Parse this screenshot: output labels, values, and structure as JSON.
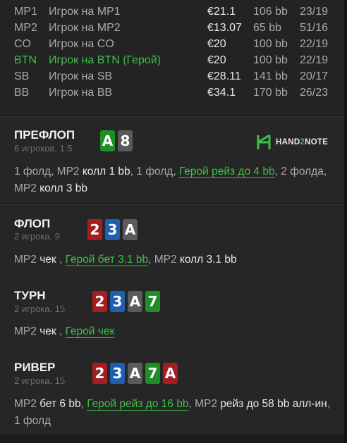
{
  "players": [
    {
      "pos": "MP1",
      "name": "Игрок на MP1",
      "stack": "€21.1",
      "bb": "106 bb",
      "ratio": "23/19",
      "hero": false
    },
    {
      "pos": "MP2",
      "name": "Игрок на MP2",
      "stack": "€13.07",
      "bb": "65 bb",
      "ratio": "51/16",
      "hero": false
    },
    {
      "pos": "CO",
      "name": "Игрок на CO",
      "stack": "€20",
      "bb": "100 bb",
      "ratio": "22/19",
      "hero": false
    },
    {
      "pos": "BTN",
      "name": "Игрок на BTN (Герой)",
      "stack": "€20",
      "bb": "100 bb",
      "ratio": "22/19",
      "hero": true
    },
    {
      "pos": "SB",
      "name": "Игрок на SB",
      "stack": "€28.11",
      "bb": "141 bb",
      "ratio": "20/17",
      "hero": false
    },
    {
      "pos": "BB",
      "name": "Игрок на BB",
      "stack": "€34.1",
      "bb": "170 bb",
      "ratio": "26/23",
      "hero": false
    }
  ],
  "logo": {
    "text_a": "HAND",
    "text_b": "2",
    "text_c": "NOTE"
  },
  "streets": {
    "preflop": {
      "title": "ПРЕФЛОП",
      "sub": "6 игроков, 1.5",
      "cards": [
        {
          "rank": "A",
          "suit": "c"
        },
        {
          "rank": "8",
          "suit": "s"
        }
      ],
      "actions": {
        "a1": "1 фолд, MP2 ",
        "a2": "колл 1 bb",
        "a3": ", 1 фолд, ",
        "a4": "Герой рейз до 4 bb",
        "a5": ", 2 фолда, MP2 ",
        "a6": "колл 3 bb"
      }
    },
    "flop": {
      "title": "ФЛОП",
      "sub": "2 игрока, 9",
      "cards": [
        {
          "rank": "2",
          "suit": "h"
        },
        {
          "rank": "3",
          "suit": "d"
        },
        {
          "rank": "A",
          "suit": "s"
        }
      ],
      "actions": {
        "a1": "MP2 ",
        "a2": "чек",
        "a3": " , ",
        "a4": "Герой бет 3.1 bb",
        "a5": ", MP2 ",
        "a6": "колл 3.1 bb"
      }
    },
    "turn": {
      "title": "ТУРН",
      "sub": "2 игрока, 15",
      "cards": [
        {
          "rank": "2",
          "suit": "h"
        },
        {
          "rank": "3",
          "suit": "d"
        },
        {
          "rank": "A",
          "suit": "s"
        },
        {
          "rank": "7",
          "suit": "c"
        }
      ],
      "actions": {
        "a1": "MP2 ",
        "a2": "чек",
        "a3": " , ",
        "a4": "Герой чек"
      }
    },
    "river": {
      "title": "РИВЕР",
      "sub": "2 игрока, 15",
      "cards": [
        {
          "rank": "2",
          "suit": "h"
        },
        {
          "rank": "3",
          "suit": "d"
        },
        {
          "rank": "A",
          "suit": "s"
        },
        {
          "rank": "7",
          "suit": "c"
        },
        {
          "rank": "A",
          "suit": "h"
        }
      ],
      "actions": {
        "a1": "MP2 ",
        "a2": "бет 6 bb",
        "a3": ", ",
        "a4": "Герой рейз до 16 bb",
        "a5": ", MP2 ",
        "a6": "рейз до 58 bb алл-ин",
        "a7": ", 1 фолд"
      }
    }
  },
  "colors": {
    "hero": "#3fbf4a",
    "hearts": "#a41e22",
    "diamonds": "#1f5fb0",
    "spades": "#5a5a5a",
    "clubs": "#1e8f26"
  }
}
